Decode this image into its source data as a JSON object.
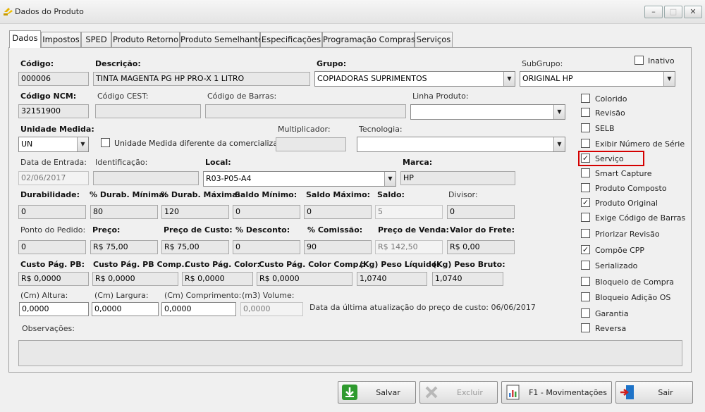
{
  "window": {
    "title": "Dados do Produto",
    "min": "–",
    "max": "□",
    "close": "✕"
  },
  "tabs": [
    "Dados",
    "Impostos",
    "SPED",
    "Produto Retorno",
    "Produto Semelhante",
    "Especificações",
    "Programação Compras",
    "Serviços"
  ],
  "row1": {
    "codigo_label": "Código:",
    "codigo": "000006",
    "descricao_label": "Descrição:",
    "descricao": "TINTA MAGENTA PG HP PRO-X 1 LITRO",
    "grupo_label": "Grupo:",
    "grupo": "COPIADORAS SUPRIMENTOS",
    "subgrupo_label": "SubGrupo:",
    "subgrupo": "ORIGINAL HP",
    "inativo_label": "Inativo"
  },
  "row2": {
    "ncm_label": "Código NCM:",
    "ncm": "32151900",
    "cest_label": "Código CEST:",
    "cest": "",
    "barras_label": "Código de Barras:",
    "barras": "",
    "linha_label": "Linha Produto:",
    "linha": ""
  },
  "row3": {
    "unidade_label": "Unidade Medida:",
    "unidade": "UN",
    "unid_diff_label": "Unidade Medida diferente da comercializada",
    "multiplicador_label": "Multiplicador:",
    "multiplicador": "",
    "tecnologia_label": "Tecnologia:",
    "tecnologia": ""
  },
  "row4": {
    "entrada_label": "Data de Entrada:",
    "entrada": "02/06/2017",
    "ident_label": "Identificação:",
    "ident": "",
    "local_label": "Local:",
    "local": "R03-P05-A4",
    "marca_label": "Marca:",
    "marca": "HP"
  },
  "row5": {
    "labels": [
      "Durabilidade:",
      "% Durab. Mínima:",
      "% Durab. Máxima:",
      "Saldo Mínimo:",
      "Saldo Máximo:",
      "Saldo:",
      "Divisor:"
    ],
    "values": [
      "0",
      "80",
      "120",
      "0",
      "0",
      "5",
      "0"
    ]
  },
  "row6": {
    "labels": [
      "Ponto do Pedido:",
      "Preço:",
      "Preço de Custo:",
      "% Desconto:",
      "% Comissão:",
      "Preço de Venda:",
      "Valor do Frete:"
    ],
    "values": [
      "0",
      "R$ 75,00",
      "R$ 75,00",
      "0",
      "90",
      "R$ 142,50",
      "R$ 0,00"
    ]
  },
  "row7": {
    "labels": [
      "Custo Pág. PB:",
      "Custo Pág. PB Comp.:",
      "Custo Pág. Color:",
      "Custo Pág. Color Comp.:",
      "(Kg) Peso Líquido:",
      "(Kg) Peso Bruto:"
    ],
    "values": [
      "R$ 0,0000",
      "R$ 0,0000",
      "R$ 0,0000",
      "R$ 0,0000",
      "1,0740",
      "1,0740"
    ]
  },
  "row8": {
    "labels": [
      "(Cm) Altura:",
      "(Cm) Largura:",
      "(Cm) Comprimento:",
      "(m3) Volume:"
    ],
    "values": [
      "0,0000",
      "0,0000",
      "0,0000",
      "0,0000"
    ],
    "update_text": "Data da última atualização do preço de custo: 06/06/2017"
  },
  "observacoes_label": "Observações:",
  "observacoes": "",
  "flags": [
    {
      "label": "Colorido",
      "checked": false
    },
    {
      "label": "Revisão",
      "checked": false
    },
    {
      "label": "SELB",
      "checked": false
    },
    {
      "label": "Exibir Número de Série",
      "checked": false
    },
    {
      "label": "Serviço",
      "checked": true
    },
    {
      "label": "Smart Capture",
      "checked": false
    },
    {
      "label": "Produto Composto",
      "checked": false
    },
    {
      "label": "Produto Original",
      "checked": true
    },
    {
      "label": "Exige Código de Barras",
      "checked": false
    },
    {
      "label": "Priorizar Revisão",
      "checked": false
    },
    {
      "label": "Compõe CPP",
      "checked": true
    },
    {
      "label": "Serializado",
      "checked": false
    },
    {
      "label": "Bloqueio de Compra",
      "checked": false
    },
    {
      "label": "Bloqueio Adição OS",
      "checked": false
    },
    {
      "label": "Garantia",
      "checked": false
    },
    {
      "label": "Reversa",
      "checked": false
    }
  ],
  "buttons": {
    "salvar": "Salvar",
    "excluir": "Excluir",
    "movimentacoes": "F1 - Movimentações",
    "sair": "Sair"
  },
  "colors": {
    "highlight": "#d40000",
    "salvar_icon": "#2e9a2e",
    "sair_icon": "#1e73c8"
  }
}
